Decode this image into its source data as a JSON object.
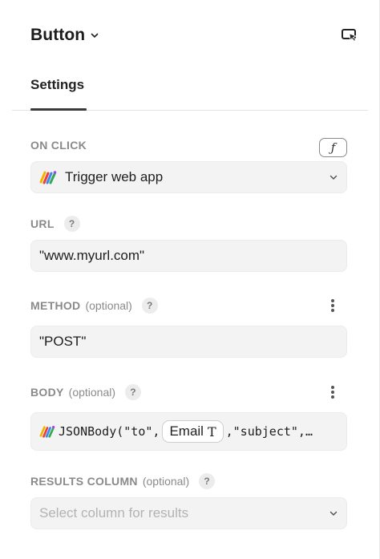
{
  "header": {
    "title": "Button",
    "title_menu_icon": "chevron-down-icon",
    "action_icon": "preview-cursor-icon"
  },
  "tabs": [
    {
      "label": "Settings",
      "active": true
    }
  ],
  "on_click": {
    "label": "ON CLICK",
    "fx_label": "ƒ",
    "value": "Trigger web app",
    "app_icon": "web-app-colorful-icon"
  },
  "url": {
    "label": "URL",
    "help": "?",
    "value": "\"www.myurl.com\""
  },
  "method": {
    "label": "METHOD",
    "optional": "(optional)",
    "help": "?",
    "value": "\"POST\""
  },
  "body": {
    "label": "BODY",
    "optional": "(optional)",
    "help": "?",
    "code_prefix": "JSONBody(\"to\",",
    "chip_label": "Email",
    "chip_type": "T",
    "code_suffix": ",\"subject\",…"
  },
  "results_column": {
    "label": "RESULTS COLUMN",
    "optional": "(optional)",
    "help": "?",
    "placeholder": "Select column for results"
  },
  "colors": {
    "section_label": "#8a8a8a",
    "field_bg": "#f3f3f3",
    "help_bg": "#ececec"
  }
}
